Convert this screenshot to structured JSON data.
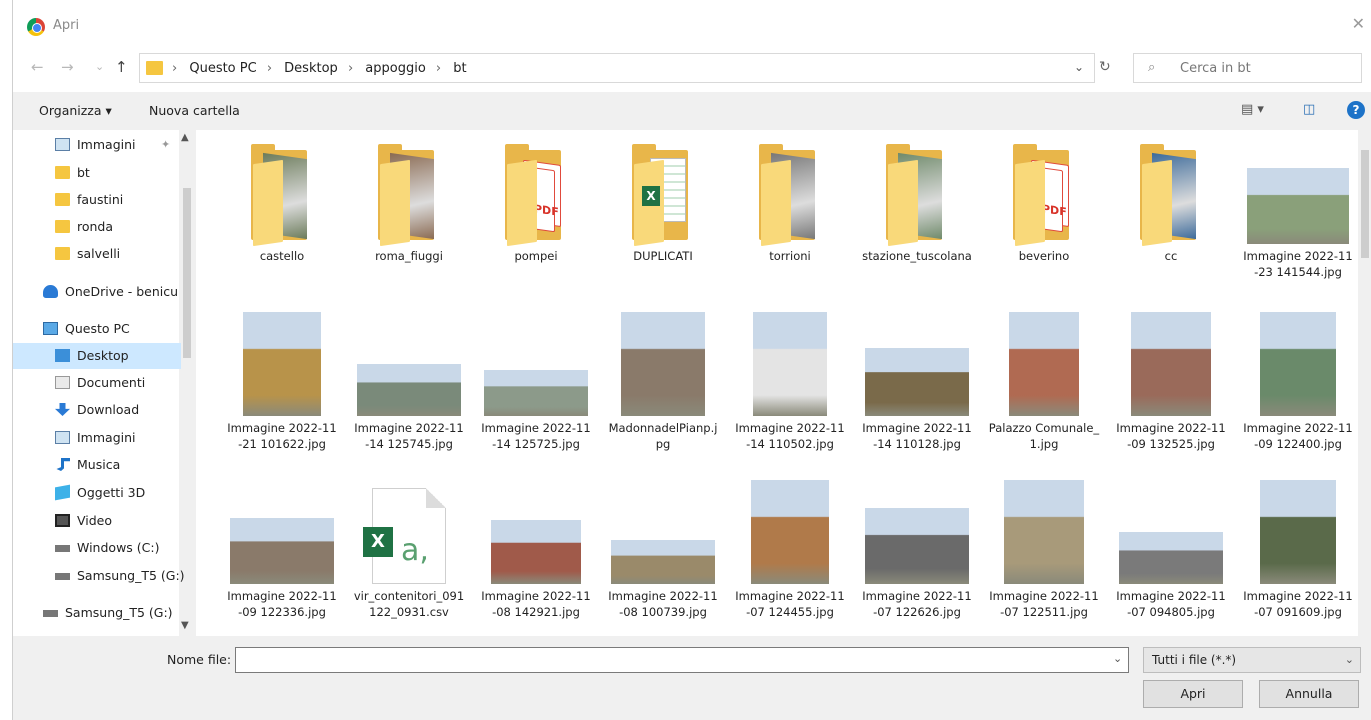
{
  "window": {
    "title": "Apri",
    "close": "✕"
  },
  "nav": {
    "back": "←",
    "forward": "→",
    "recent": "⌄",
    "up": "↑"
  },
  "address": {
    "crumbs": [
      "Questo PC",
      "Desktop",
      "appoggio",
      "bt"
    ],
    "separator": "›",
    "dropdown": "⌄",
    "refresh": "↻"
  },
  "search": {
    "placeholder": "Cerca in bt",
    "icon": "⌕"
  },
  "toolbar": {
    "organize": "Organizza ▾",
    "new_folder": "Nuova cartella",
    "view_icon": "▤ ▾",
    "pane_icon": "◫",
    "help": "?"
  },
  "sidebar": {
    "items": [
      {
        "label": "Immagini",
        "icon": "ico-img",
        "name": "sidebar-item-immagini-quick"
      },
      {
        "label": "bt",
        "icon": "ico-folder",
        "name": "sidebar-item-bt"
      },
      {
        "label": "faustini",
        "icon": "ico-folder",
        "name": "sidebar-item-faustini"
      },
      {
        "label": "ronda",
        "icon": "ico-folder",
        "name": "sidebar-item-ronda"
      },
      {
        "label": "salvelli",
        "icon": "ico-folder",
        "name": "sidebar-item-salvelli"
      },
      {
        "label": "OneDrive - benicu",
        "icon": "ico-cloud",
        "name": "sidebar-item-onedrive"
      },
      {
        "label": "Questo PC",
        "icon": "ico-pc",
        "name": "sidebar-item-questo-pc"
      },
      {
        "label": "Desktop",
        "icon": "ico-desk",
        "name": "sidebar-item-desktop",
        "selected": true
      },
      {
        "label": "Documenti",
        "icon": "ico-doc",
        "name": "sidebar-item-documenti"
      },
      {
        "label": "Download",
        "icon": "ico-down",
        "name": "sidebar-item-download"
      },
      {
        "label": "Immagini",
        "icon": "ico-img",
        "name": "sidebar-item-immagini"
      },
      {
        "label": "Musica",
        "icon": "ico-music",
        "name": "sidebar-item-musica"
      },
      {
        "label": "Oggetti 3D",
        "icon": "ico-3d",
        "name": "sidebar-item-oggetti-3d"
      },
      {
        "label": "Video",
        "icon": "ico-video",
        "name": "sidebar-item-video"
      },
      {
        "label": "Windows  (C:)",
        "icon": "ico-drive",
        "name": "sidebar-item-windows-c"
      },
      {
        "label": "Samsung_T5 (G:)",
        "icon": "ico-drive",
        "name": "sidebar-item-samsung-t5-a"
      },
      {
        "label": "Samsung_T5 (G:)",
        "icon": "ico-drive",
        "name": "sidebar-item-samsung-t5-b"
      }
    ],
    "pin_icon": "📌"
  },
  "files": {
    "row1": [
      {
        "name": "castello",
        "kind": "folder-photo",
        "color": "#6b7b5a"
      },
      {
        "name": "roma_fiuggi",
        "kind": "folder-photo",
        "color": "#8a6a52"
      },
      {
        "name": "pompei",
        "kind": "folder-pdf"
      },
      {
        "name": "DUPLICATI",
        "kind": "folder-xls"
      },
      {
        "name": "torrioni",
        "kind": "folder-photo",
        "color": "#777777"
      },
      {
        "name": "stazione_tuscolana",
        "kind": "folder-photo",
        "color": "#6f8a6a"
      },
      {
        "name": "beverino",
        "kind": "folder-pdf"
      },
      {
        "name": "cc",
        "kind": "folder-photo",
        "color": "#3c6a9a"
      },
      {
        "name": "Immagine 2022-11-23 141544.jpg",
        "kind": "photo",
        "color": "#8aa07a"
      }
    ],
    "row2": [
      {
        "name": "Immagine 2022-11-21 101622.jpg",
        "kind": "photo",
        "color": "#b8934a"
      },
      {
        "name": "Immagine 2022-11-14 125745.jpg",
        "kind": "photo",
        "color": "#7a8a7a"
      },
      {
        "name": "Immagine 2022-11-14 125725.jpg",
        "kind": "photo",
        "color": "#8c9a8a"
      },
      {
        "name": "MadonnadelPianp.jpg",
        "kind": "photo",
        "color": "#8a7a6a"
      },
      {
        "name": "Immagine 2022-11-14 110502.jpg",
        "kind": "photo",
        "color": "#e4e4e4"
      },
      {
        "name": "Immagine 2022-11-14 110128.jpg",
        "kind": "photo",
        "color": "#7a6a4a"
      },
      {
        "name": "Palazzo Comunale_1.jpg",
        "kind": "photo",
        "color": "#b06a52"
      },
      {
        "name": "Immagine 2022-11-09 132525.jpg",
        "kind": "photo",
        "color": "#9a6a5a"
      },
      {
        "name": "Immagine 2022-11-09 122400.jpg",
        "kind": "photo",
        "color": "#6a8a6a"
      }
    ],
    "row3": [
      {
        "name": "Immagine 2022-11-09 122336.jpg",
        "kind": "photo",
        "color": "#8a7a6a"
      },
      {
        "name": "vir_contenitori_091122_0931.csv",
        "kind": "csv"
      },
      {
        "name": "Immagine 2022-11-08 142921.jpg",
        "kind": "photo",
        "color": "#a05a4a"
      },
      {
        "name": "Immagine 2022-11-08 100739.jpg",
        "kind": "photo",
        "color": "#9a8a6a"
      },
      {
        "name": "Immagine 2022-11-07 124455.jpg",
        "kind": "photo",
        "color": "#b07a4a"
      },
      {
        "name": "Immagine 2022-11-07 122626.jpg",
        "kind": "photo",
        "color": "#6a6a6a"
      },
      {
        "name": "Immagine 2022-11-07 122511.jpg",
        "kind": "photo",
        "color": "#a89a7a"
      },
      {
        "name": "Immagine 2022-11-07 094805.jpg",
        "kind": "photo",
        "color": "#7a7a7a"
      },
      {
        "name": "Immagine 2022-11-07 091609.jpg",
        "kind": "photo",
        "color": "#5a6a4a"
      }
    ]
  },
  "bottom": {
    "filename_label": "Nome file:",
    "filename_value": "",
    "filename_dropdown": "⌄",
    "filter_value": "Tutti i file (*.*)",
    "filter_dropdown": "⌄",
    "open_button": "Apri",
    "cancel_button": "Annulla"
  }
}
